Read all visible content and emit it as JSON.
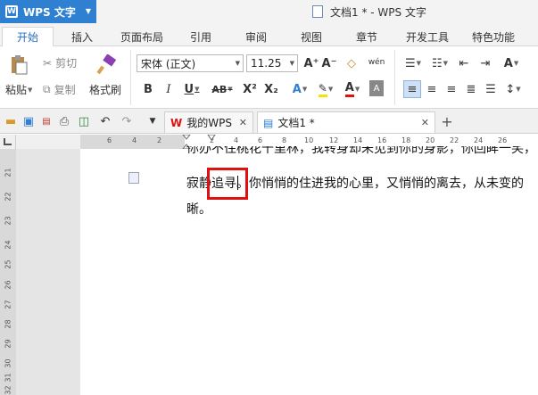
{
  "titlebar": {
    "app_name": "WPS 文字",
    "app_logo_text": "W",
    "document_title": "文档1 * - WPS 文字"
  },
  "ribbon_tabs": [
    "开始",
    "插入",
    "页面布局",
    "引用",
    "审阅",
    "视图",
    "章节",
    "开发工具",
    "特色功能"
  ],
  "active_tab": "开始",
  "ribbon": {
    "paste_label": "粘贴",
    "cut_label": "剪切",
    "copy_label": "复制",
    "format_painter_label": "格式刷",
    "font_name": "宋体 (正文)",
    "font_size": "11.25",
    "bold": "B",
    "italic": "I",
    "underline": "U",
    "strikethrough": "AB",
    "superscript": "X²",
    "subscript": "X₂",
    "font_color": "A",
    "grow_font": "A⁺",
    "shrink_font": "A⁻",
    "phonetic": "wén"
  },
  "doc_tabs": [
    {
      "label": "我的WPS",
      "active": false
    },
    {
      "label": "文档1 *",
      "active": true
    }
  ],
  "ruler": {
    "h_ticks": [
      "6",
      "4",
      "2",
      "2",
      "4",
      "6",
      "8",
      "10",
      "12",
      "14",
      "16",
      "18",
      "20",
      "22",
      "24",
      "26"
    ],
    "v_ticks": [
      "21",
      "22",
      "23",
      "24",
      "25",
      "26",
      "27",
      "28",
      "29",
      "30",
      "31",
      "32"
    ]
  },
  "document": {
    "line1": "你办不住桃花千里林，我转身却未见到你的身影，你回眸一笑，",
    "line2": "寂静追寻。你悄悄的住进我的心里，又悄悄的离去，从未变的",
    "line3": "晰。",
    "highlighted_text": "追寻"
  },
  "colors": {
    "accent": "#2f80d1",
    "highlight_border": "#e01010",
    "active_tab_text": "#2b6fc2"
  }
}
